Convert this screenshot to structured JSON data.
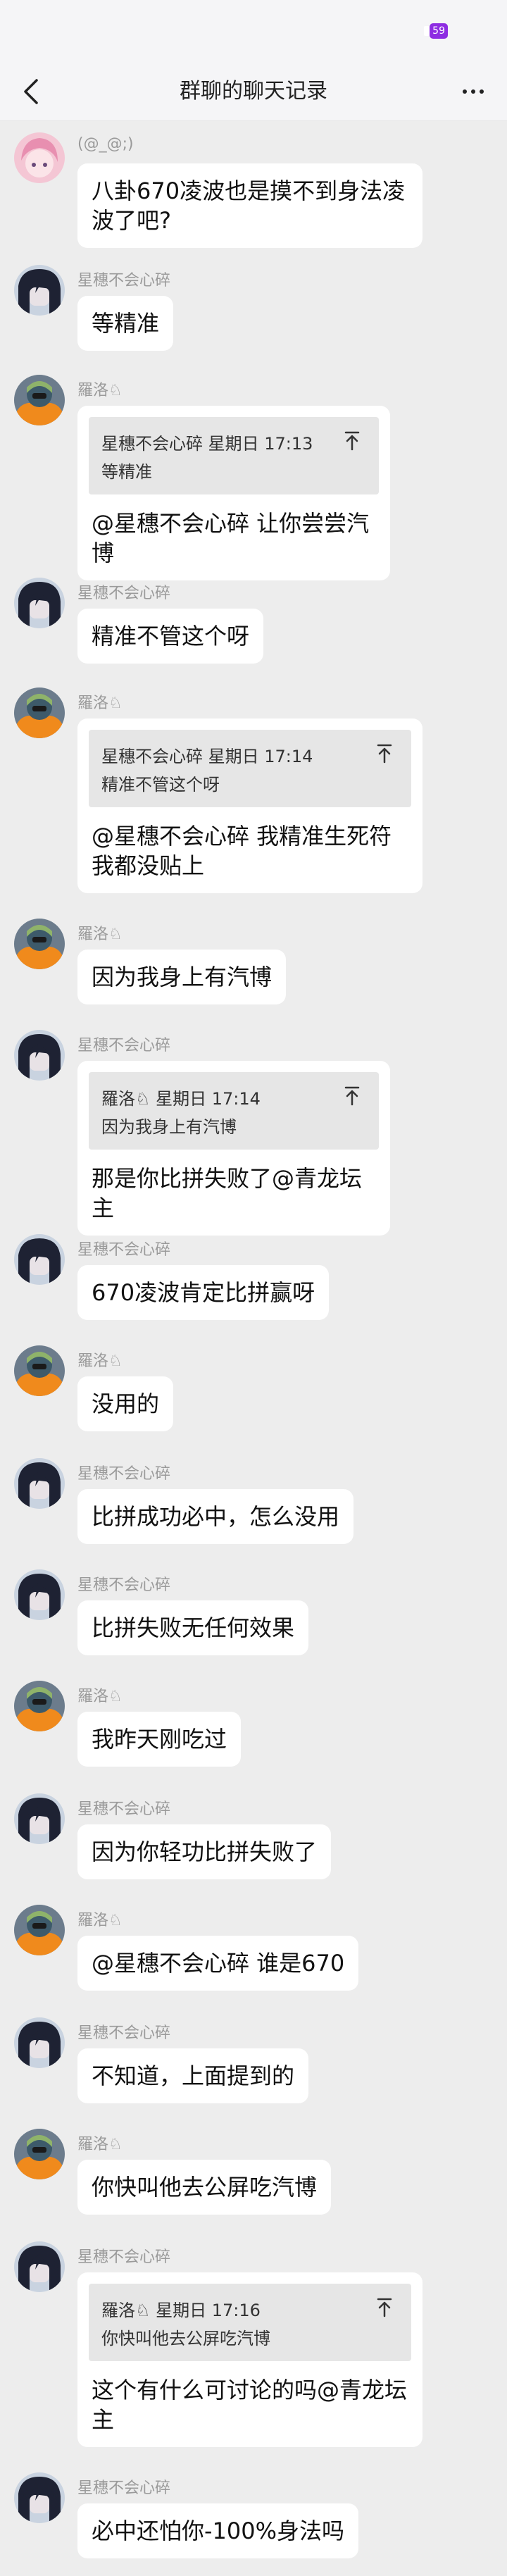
{
  "status_bar": {
    "battery": "59"
  },
  "header": {
    "title": "群聊的聊天记录"
  },
  "icons": {
    "back": "chevron-left-icon",
    "more": "more-dots-icon",
    "quote_jump": "jump-to-original-icon"
  },
  "messages": [
    {
      "sender": "(@_@;)",
      "avatar": "pink-hair",
      "text": "八卦670凌波也是摸不到身法凌波了吧?"
    },
    {
      "sender": "星穗不会心碎",
      "avatar": "dark-hair",
      "text": "等精准"
    },
    {
      "sender": "羅洛♘",
      "avatar": "orange-helmet",
      "quote": {
        "header": "星穗不会心碎 星期日 17:13",
        "text": "等精准"
      },
      "text": "@星穗不会心碎 让你尝尝汽博"
    },
    {
      "sender": "星穗不会心碎",
      "avatar": "dark-hair",
      "text": "精准不管这个呀"
    },
    {
      "sender": "羅洛♘",
      "avatar": "orange-helmet",
      "quote": {
        "header": "星穗不会心碎 星期日 17:14",
        "text": "精准不管这个呀"
      },
      "text": "@星穗不会心碎 我精准生死符我都没贴上"
    },
    {
      "sender": "羅洛♘",
      "avatar": "orange-helmet",
      "text": "因为我身上有汽博"
    },
    {
      "sender": "星穗不会心碎",
      "avatar": "dark-hair",
      "quote": {
        "header": "羅洛♘ 星期日 17:14",
        "text": "因为我身上有汽博"
      },
      "text": "那是你比拼失败了@青龙坛主"
    },
    {
      "sender": "星穗不会心碎",
      "avatar": "dark-hair",
      "text": "670凌波肯定比拼赢呀"
    },
    {
      "sender": "羅洛♘",
      "avatar": "orange-helmet",
      "text": "没用的"
    },
    {
      "sender": "星穗不会心碎",
      "avatar": "dark-hair",
      "text": "比拼成功必中，怎么没用"
    },
    {
      "sender": "星穗不会心碎",
      "avatar": "dark-hair",
      "text": "比拼失败无任何效果"
    },
    {
      "sender": "羅洛♘",
      "avatar": "orange-helmet",
      "text": "我昨天刚吃过"
    },
    {
      "sender": "星穗不会心碎",
      "avatar": "dark-hair",
      "text": "因为你轻功比拼失败了"
    },
    {
      "sender": "羅洛♘",
      "avatar": "orange-helmet",
      "text": "@星穗不会心碎 谁是670"
    },
    {
      "sender": "星穗不会心碎",
      "avatar": "dark-hair",
      "text": "不知道，上面提到的"
    },
    {
      "sender": "羅洛♘",
      "avatar": "orange-helmet",
      "text": "你快叫他去公屏吃汽博"
    },
    {
      "sender": "星穗不会心碎",
      "avatar": "dark-hair",
      "quote": {
        "header": "羅洛♘ 星期日 17:16",
        "text": "你快叫他去公屏吃汽博"
      },
      "text": "这个有什么可讨论的吗@青龙坛主"
    },
    {
      "sender": "星穗不会心碎",
      "avatar": "dark-hair",
      "text": "必中还怕你-100%身法吗"
    }
  ]
}
